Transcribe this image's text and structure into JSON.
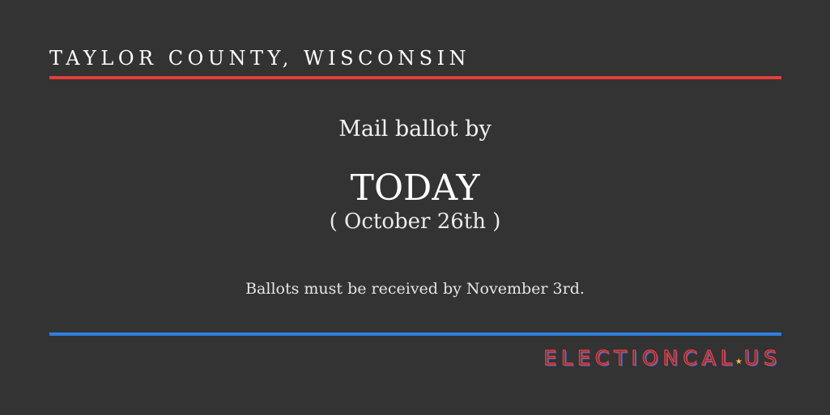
{
  "header": {
    "location": "TAYLOR COUNTY, WISCONSIN"
  },
  "body": {
    "lead": "Mail ballot by",
    "deadline": "TODAY",
    "date": "( October 26th )",
    "note": "Ballots must be received by November 3rd."
  },
  "brand": {
    "name_part1": "ELECTIONCAL",
    "star": "★",
    "name_part2": "US"
  },
  "colors": {
    "background": "#333333",
    "accent_red": "#e2403a",
    "accent_blue": "#2f7fe0",
    "star_gold": "#f2c230"
  }
}
